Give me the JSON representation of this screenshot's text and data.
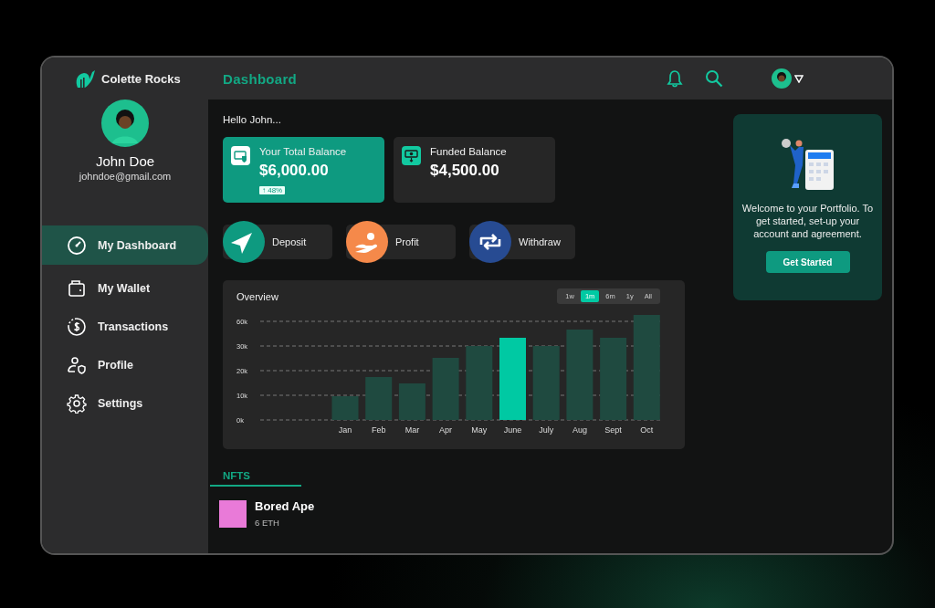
{
  "brand": {
    "name": "Colette Rocks"
  },
  "header": {
    "title": "Dashboard"
  },
  "user": {
    "name": "John Doe",
    "email": "johndoe@gmail.com"
  },
  "sidebar": {
    "items": [
      {
        "label": "My Dashboard",
        "selected": true
      },
      {
        "label": "My Wallet",
        "selected": false
      },
      {
        "label": "Transactions",
        "selected": false
      },
      {
        "label": "Profile",
        "selected": false
      },
      {
        "label": "Settings",
        "selected": false
      }
    ]
  },
  "greeting": "Hello John...",
  "balances": [
    {
      "label": "Your Total Balance",
      "amount": "$6,000.00",
      "change": "↑ 48%",
      "selected": true
    },
    {
      "label": "Funded Balance",
      "amount": "$4,500.00",
      "selected": false
    }
  ],
  "actions": [
    {
      "label": "Deposit",
      "color": "#0e9a80"
    },
    {
      "label": "Profit",
      "color": "#f5894a"
    },
    {
      "label": "Withdraw",
      "color": "#274b92"
    }
  ],
  "overview": {
    "title": "Overview",
    "ranges": [
      {
        "label": "1w",
        "selected": false
      },
      {
        "label": "1m",
        "selected": true
      },
      {
        "label": "6m",
        "selected": false
      },
      {
        "label": "1y",
        "selected": false
      },
      {
        "label": "All",
        "selected": false
      }
    ],
    "y_labels": [
      "60k",
      "30k",
      "20k",
      "10k",
      "0k"
    ],
    "bars": [
      {
        "label": "Jan",
        "selected": false
      },
      {
        "label": "Feb",
        "selected": false
      },
      {
        "label": "Mar",
        "selected": false
      },
      {
        "label": "Apr",
        "selected": false
      },
      {
        "label": "May",
        "selected": false
      },
      {
        "label": "June",
        "selected": true
      },
      {
        "label": "July",
        "selected": false
      },
      {
        "label": "Aug",
        "selected": false
      },
      {
        "label": "Sept",
        "selected": false
      },
      {
        "label": "Oct",
        "selected": false
      }
    ]
  },
  "welcome": {
    "text": "Welcome to your Portfolio. To get started, set-up your account and agreement.",
    "button": "Get Started"
  },
  "nfts": {
    "tab": "NFTS",
    "items": [
      {
        "name": "Bored Ape",
        "price": "6 ETH"
      }
    ]
  }
}
